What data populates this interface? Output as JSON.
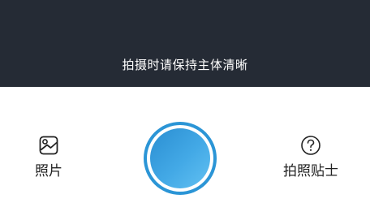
{
  "camera": {
    "hint": "拍摄时请保持主体清晰"
  },
  "toolbar": {
    "photos_label": "照片",
    "photos_icon": "image-icon",
    "tips_label": "拍照贴士",
    "tips_icon": "help-circle-icon",
    "shutter_icon": "shutter-button"
  },
  "colors": {
    "preview_background": "#252b35",
    "shutter_accent": "#2b95d6",
    "text": "#222222"
  }
}
